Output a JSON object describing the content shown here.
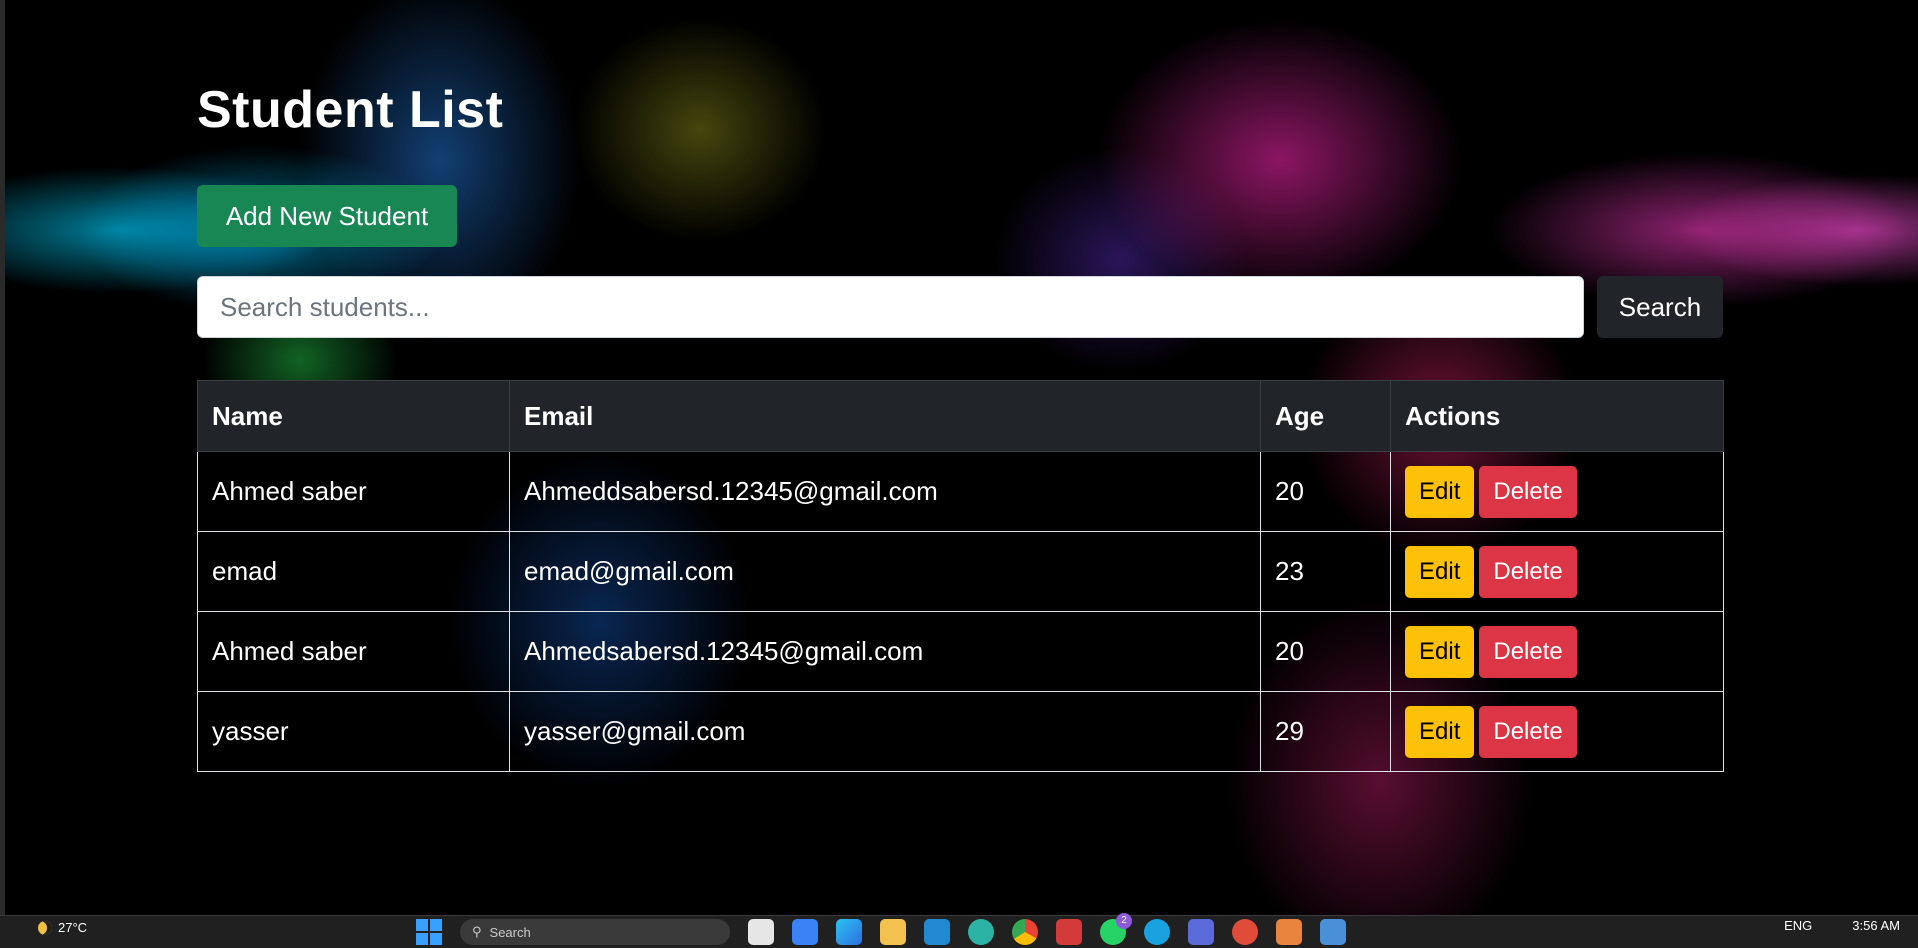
{
  "page": {
    "title": "Student List",
    "add_button": "Add New Student",
    "search": {
      "placeholder": "Search students...",
      "value": "",
      "button": "Search"
    }
  },
  "table": {
    "headers": [
      "Name",
      "Email",
      "Age",
      "Actions"
    ],
    "rows": [
      {
        "name": "Ahmed saber",
        "email": "Ahmeddsabersd.12345@gmail.com",
        "age": "20"
      },
      {
        "name": "emad",
        "email": "emad@gmail.com",
        "age": "23"
      },
      {
        "name": "Ahmed saber",
        "email": "Ahmedsabersd.12345@gmail.com",
        "age": "20"
      },
      {
        "name": "yasser",
        "email": "yasser@gmail.com",
        "age": "29"
      }
    ],
    "edit_label": "Edit",
    "delete_label": "Delete"
  },
  "colors": {
    "add_button": "#198754",
    "search_button": "#212529",
    "edit_button": "#ffc107",
    "delete_button": "#dc3545"
  },
  "taskbar": {
    "weather": "27°C",
    "search_placeholder": "Search",
    "notification_count": "2",
    "language": "ENG",
    "time": "3:56 AM",
    "icons": [
      "windows-start-icon",
      "search-icon",
      "file-explorer-icon",
      "store-icon",
      "edge-icon",
      "folder-icon",
      "vscode-icon",
      "browser-icon",
      "chrome-icon",
      "app-icon",
      "whatsapp-icon",
      "app-icon",
      "app-icon",
      "app-icon",
      "app-icon",
      "calendar-icon"
    ]
  }
}
